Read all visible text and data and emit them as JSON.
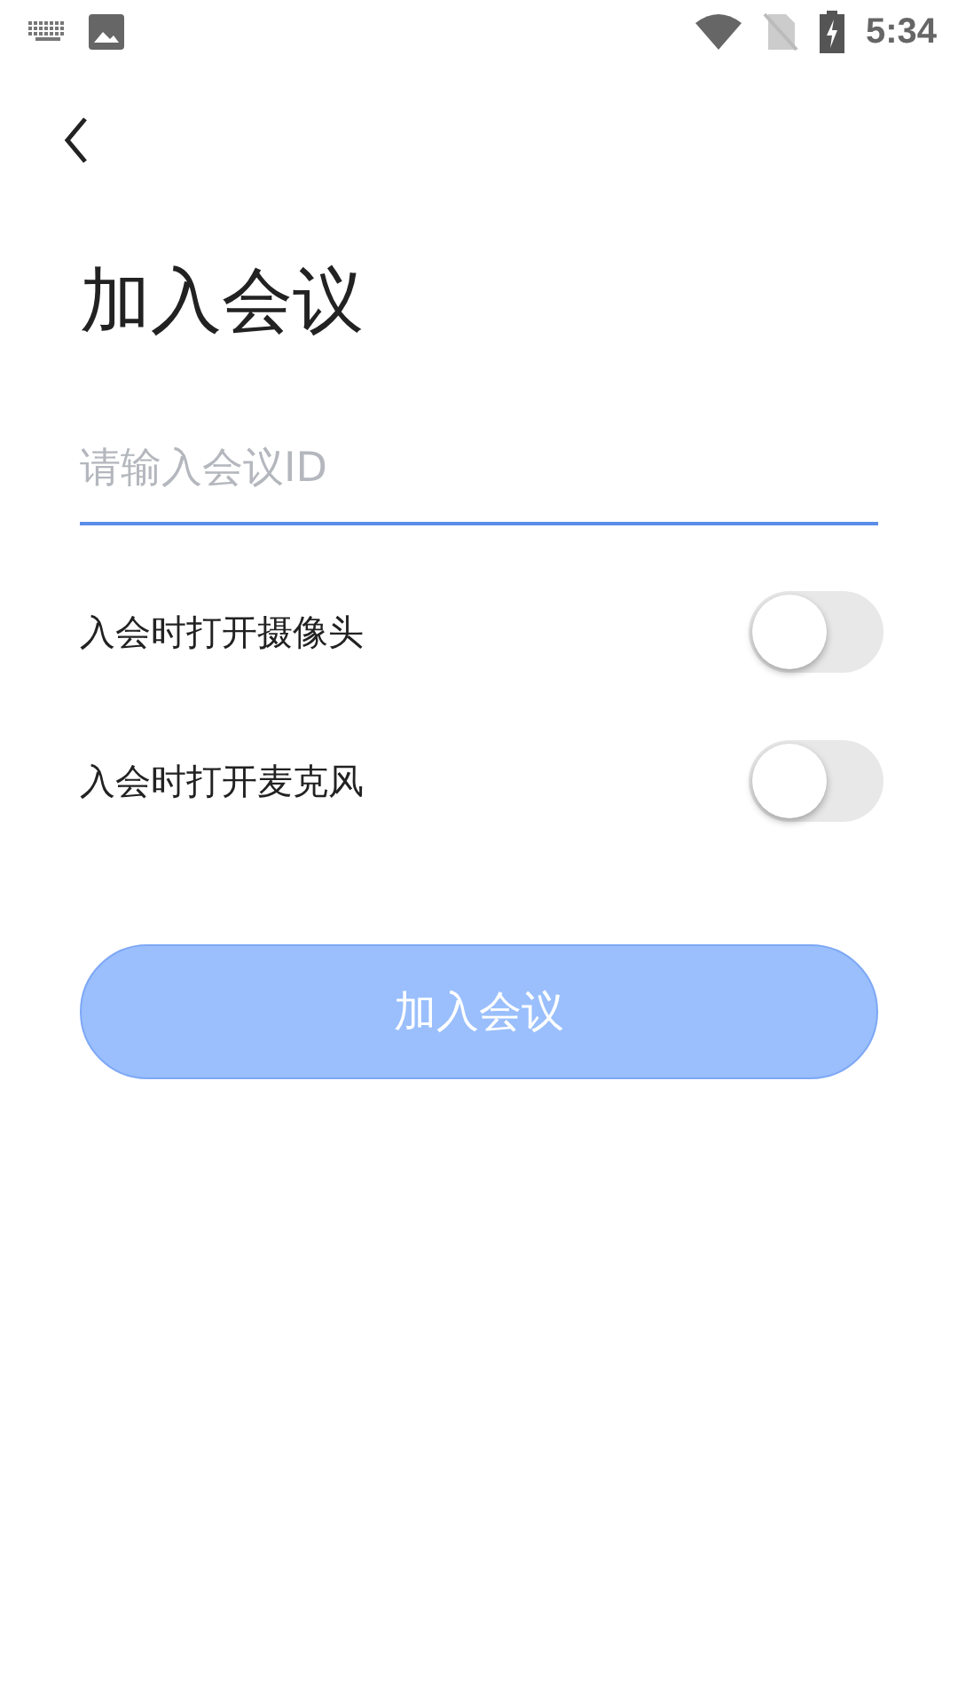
{
  "status_bar": {
    "time": "5:34"
  },
  "title": "加入会议",
  "meeting_id_field": {
    "placeholder": "请输入会议ID"
  },
  "options": [
    {
      "label": "入会时打开摄像头",
      "on": false
    },
    {
      "label": "入会时打开麦克风",
      "on": false
    }
  ],
  "join_button": {
    "label": "加入会议",
    "disabled": true
  }
}
